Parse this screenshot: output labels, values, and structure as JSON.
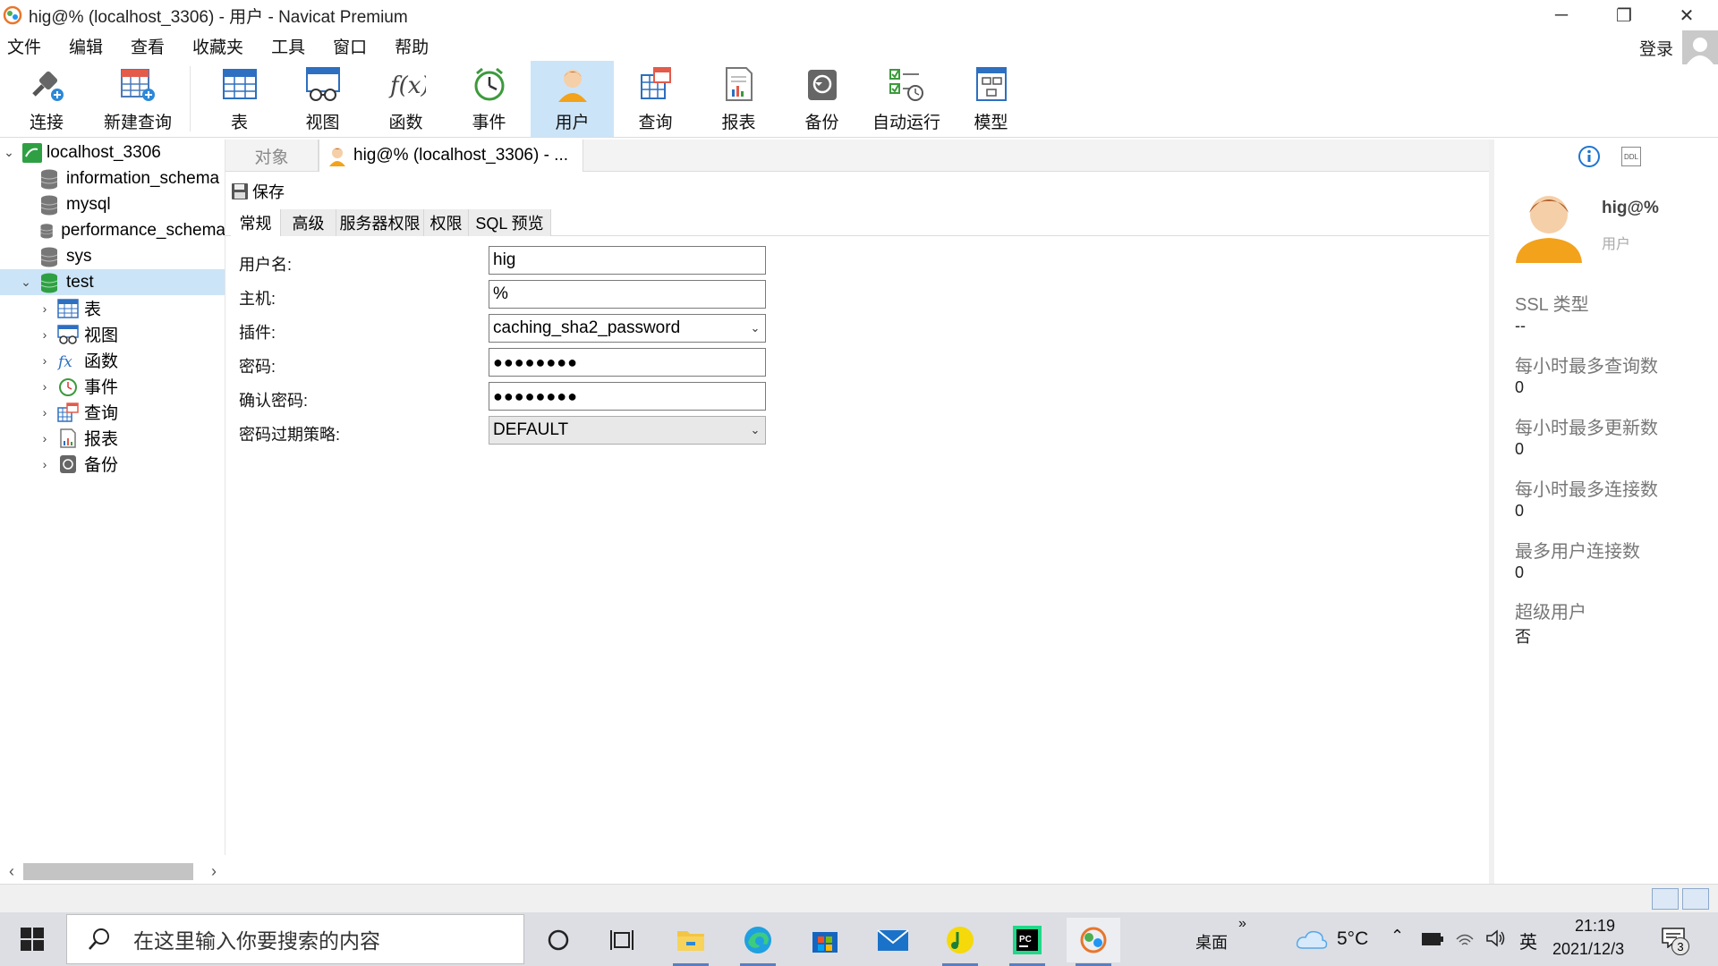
{
  "window": {
    "title": "hig@% (localhost_3306) - 用户 - Navicat Premium",
    "minimize": "─",
    "maximize": "❐",
    "close": "✕"
  },
  "menu": [
    "文件",
    "编辑",
    "查看",
    "收藏夹",
    "工具",
    "窗口",
    "帮助"
  ],
  "login_label": "登录",
  "toolbar": [
    {
      "label": "连接",
      "icon": "connect-icon"
    },
    {
      "label": "新建查询",
      "icon": "new-query-icon"
    },
    {
      "label": "表",
      "icon": "table-icon"
    },
    {
      "label": "视图",
      "icon": "view-icon"
    },
    {
      "label": "函数",
      "icon": "function-icon"
    },
    {
      "label": "事件",
      "icon": "event-icon"
    },
    {
      "label": "用户",
      "icon": "user-icon",
      "active": true
    },
    {
      "label": "查询",
      "icon": "query-icon"
    },
    {
      "label": "报表",
      "icon": "report-icon"
    },
    {
      "label": "备份",
      "icon": "backup-icon"
    },
    {
      "label": "自动运行",
      "icon": "automation-icon"
    },
    {
      "label": "模型",
      "icon": "model-icon"
    }
  ],
  "tree": {
    "connection": "localhost_3306",
    "databases": [
      "information_schema",
      "mysql",
      "performance_schema",
      "sys"
    ],
    "selected_db": "test",
    "children": [
      "表",
      "视图",
      "函数",
      "事件",
      "查询",
      "报表",
      "备份"
    ]
  },
  "tabs": {
    "objects": "对象",
    "current": "hig@% (localhost_3306) - ..."
  },
  "save_label": "保存",
  "subtabs": [
    "常规",
    "高级",
    "服务器权限",
    "权限",
    "SQL 预览"
  ],
  "form": {
    "username_label": "用户名:",
    "username": "hig",
    "host_label": "主机:",
    "host": "%",
    "plugin_label": "插件:",
    "plugin": "caching_sha2_password",
    "password_label": "密码:",
    "password": "●●●●●●●●",
    "confirm_label": "确认密码:",
    "confirm": "●●●●●●●●",
    "expire_label": "密码过期策略:",
    "expire": "DEFAULT"
  },
  "info": {
    "name": "hig@%",
    "type": "用户",
    "ddl": "DDL",
    "ssl_label": "SSL 类型",
    "ssl_value": "--",
    "max_queries_label": "每小时最多查询数",
    "max_queries": "0",
    "max_updates_label": "每小时最多更新数",
    "max_updates": "0",
    "max_connections_label": "每小时最多连接数",
    "max_connections": "0",
    "max_user_conn_label": "最多用户连接数",
    "max_user_conn": "0",
    "super_label": "超级用户",
    "super_value": "否"
  },
  "taskbar": {
    "search_placeholder": "在这里输入你要搜索的内容",
    "desktop": "桌面",
    "overflow": "»",
    "weather": "5°C",
    "ime": "英",
    "time": "21:19",
    "date": "2021/12/3",
    "notifications": "3"
  }
}
